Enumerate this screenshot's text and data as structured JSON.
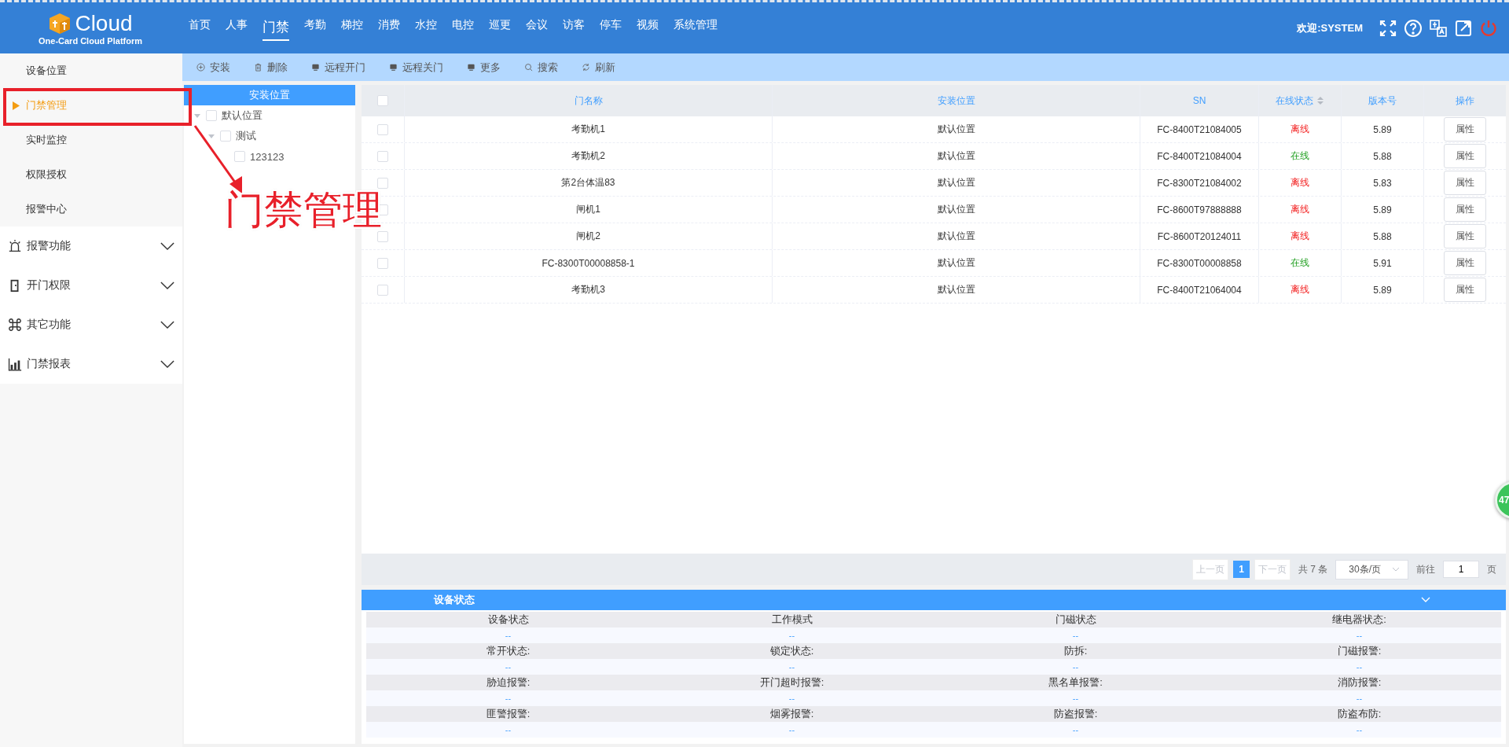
{
  "header": {
    "logo_text": "Cloud",
    "logo_subtitle": "One-Card Cloud Platform",
    "welcome": "欢迎:SYSTEM",
    "nav": [
      {
        "label": "首页",
        "selected": false
      },
      {
        "label": "人事",
        "selected": false
      },
      {
        "label": "门禁",
        "selected": true
      },
      {
        "label": "考勤",
        "selected": false
      },
      {
        "label": "梯控",
        "selected": false
      },
      {
        "label": "消费",
        "selected": false
      },
      {
        "label": "水控",
        "selected": false
      },
      {
        "label": "电控",
        "selected": false
      },
      {
        "label": "巡更",
        "selected": false
      },
      {
        "label": "会议",
        "selected": false
      },
      {
        "label": "访客",
        "selected": false
      },
      {
        "label": "停车",
        "selected": false
      },
      {
        "label": "视频",
        "selected": false
      },
      {
        "label": "系统管理",
        "selected": false
      }
    ]
  },
  "sidebar": {
    "items": [
      {
        "label": "设备位置",
        "selected": false
      },
      {
        "label": "门禁管理",
        "selected": true
      },
      {
        "label": "实时监控",
        "selected": false
      },
      {
        "label": "权限授权",
        "selected": false
      },
      {
        "label": "报警中心",
        "selected": false
      }
    ],
    "groups": [
      {
        "label": "报警功能",
        "kind": "alarm",
        "expanded": false
      },
      {
        "label": "开门权限",
        "kind": "door",
        "expanded": false
      },
      {
        "label": "其它功能",
        "kind": "command",
        "expanded": false
      },
      {
        "label": "门禁报表",
        "kind": "chart",
        "expanded": false
      }
    ]
  },
  "toolbar": [
    {
      "label": "安装",
      "kind": "add"
    },
    {
      "label": "删除",
      "kind": "delete"
    },
    {
      "label": "远程开门",
      "kind": "monitor"
    },
    {
      "label": "远程关门",
      "kind": "monitor"
    },
    {
      "label": "更多",
      "kind": "monitor"
    },
    {
      "label": "搜索",
      "kind": "search"
    },
    {
      "label": "刷新",
      "kind": "refresh"
    }
  ],
  "tree": {
    "title": "安装位置",
    "nodes": [
      {
        "label": "默认位置",
        "checked": false,
        "expanded": true,
        "children": [
          {
            "label": "测试",
            "checked": false,
            "expanded": true,
            "children": [
              {
                "label": "123123",
                "checked": false
              }
            ]
          }
        ]
      }
    ]
  },
  "table": {
    "all_checked": false,
    "columns": [
      {
        "label": "门名称"
      },
      {
        "label": "安装位置"
      },
      {
        "label": "SN"
      },
      {
        "label": "在线状态",
        "sortable": true
      },
      {
        "label": "版本号"
      },
      {
        "label": "操作"
      }
    ],
    "rows": [
      {
        "checked": false,
        "name": "考勤机1",
        "location": "默认位置",
        "sn": "FC-8400T21084005",
        "status": "离线",
        "online": false,
        "version": "5.89",
        "action": "属性"
      },
      {
        "checked": false,
        "name": "考勤机2",
        "location": "默认位置",
        "sn": "FC-8400T21084004",
        "status": "在线",
        "online": true,
        "version": "5.88",
        "action": "属性"
      },
      {
        "checked": false,
        "name": "第2台体温83",
        "location": "默认位置",
        "sn": "FC-8300T21084002",
        "status": "离线",
        "online": false,
        "version": "5.83",
        "action": "属性"
      },
      {
        "checked": false,
        "name": "闸机1",
        "location": "默认位置",
        "sn": "FC-8600T97888888",
        "status": "离线",
        "online": false,
        "version": "5.89",
        "action": "属性"
      },
      {
        "checked": false,
        "name": "闸机2",
        "location": "默认位置",
        "sn": "FC-8600T20124011",
        "status": "离线",
        "online": false,
        "version": "5.88",
        "action": "属性"
      },
      {
        "checked": false,
        "name": "FC-8300T00008858-1",
        "location": "默认位置",
        "sn": "FC-8300T00008858",
        "status": "在线",
        "online": true,
        "version": "5.91",
        "action": "属性"
      },
      {
        "checked": false,
        "name": "考勤机3",
        "location": "默认位置",
        "sn": "FC-8400T21064004",
        "status": "离线",
        "online": false,
        "version": "5.89",
        "action": "属性"
      }
    ]
  },
  "pagination": {
    "prev": "上一页",
    "pages": [
      {
        "label": "1",
        "selected": true
      }
    ],
    "next": "下一页",
    "total": "共 7 条",
    "page_size": "30条/页",
    "goto_label": "前往",
    "goto_value": "1",
    "page_unit": "页"
  },
  "status_panel": {
    "title": "设备状态",
    "expanded": true,
    "fields": [
      {
        "label": "设备状态",
        "value": "--"
      },
      {
        "label": "工作模式",
        "value": "--"
      },
      {
        "label": "门磁状态",
        "value": "--"
      },
      {
        "label": "继电器状态:",
        "value": "--"
      },
      {
        "label": "常开状态:",
        "value": "--"
      },
      {
        "label": "锁定状态:",
        "value": "--"
      },
      {
        "label": "防拆:",
        "value": "--"
      },
      {
        "label": "门磁报警:",
        "value": "--"
      },
      {
        "label": "胁迫报警:",
        "value": "--"
      },
      {
        "label": "开门超时报警:",
        "value": "--"
      },
      {
        "label": "黑名单报警:",
        "value": "--"
      },
      {
        "label": "消防报警:",
        "value": "--"
      },
      {
        "label": "匪警报警:",
        "value": "--"
      },
      {
        "label": "烟雾报警:",
        "value": "--"
      },
      {
        "label": "防盗报警:",
        "value": "--"
      },
      {
        "label": "防盗布防:",
        "value": "--"
      }
    ]
  },
  "annotation": {
    "label": "门禁管理"
  },
  "floating_badge": "47"
}
